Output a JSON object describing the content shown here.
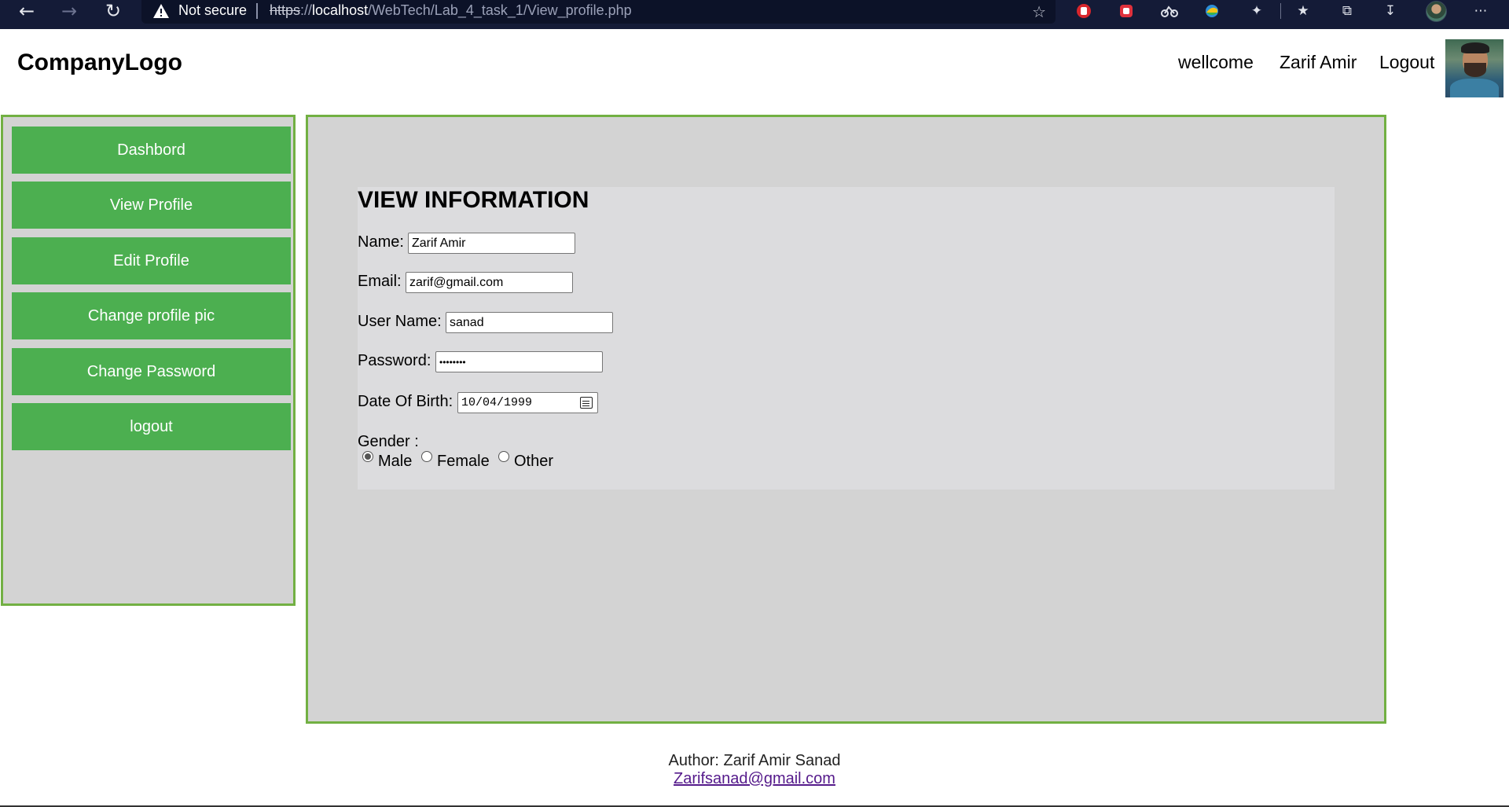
{
  "browser": {
    "security_label": "Not secure",
    "url_scheme": "https",
    "url_sep": "://",
    "url_host": "localhost",
    "url_path": "/WebTech/Lab_4_task_1/View_profile.php"
  },
  "header": {
    "logo": "CompanyLogo",
    "welcome": "wellcome",
    "user_name": "Zarif Amir",
    "logout": "Logout"
  },
  "sidebar": {
    "items": [
      {
        "label": "Dashbord"
      },
      {
        "label": "View Profile"
      },
      {
        "label": "Edit Profile"
      },
      {
        "label": "Change profile pic"
      },
      {
        "label": "Change Password"
      },
      {
        "label": "logout"
      }
    ]
  },
  "form": {
    "title": "VIEW INFORMATION",
    "name_label": "Name:",
    "name_value": "Zarif Amir",
    "email_label": "Email:",
    "email_value": "zarif@gmail.com",
    "username_label": "User Name:",
    "username_value": "sanad",
    "password_label": "Password:",
    "password_value": "••••••••",
    "dob_label": "Date Of Birth:",
    "dob_value": "10/04/1999",
    "gender_label": "Gender :",
    "gender_options": [
      "Male",
      "Female",
      "Other"
    ],
    "gender_selected": "Male"
  },
  "footer": {
    "author": "Author: Zarif Amir Sanad",
    "email": "Zarifsanad@gmail.com"
  },
  "colors": {
    "browser_bar": "#141b37",
    "sidebar_button": "#4caf50",
    "panel_border": "#72b043",
    "panel_background": "#d3d3d3"
  }
}
